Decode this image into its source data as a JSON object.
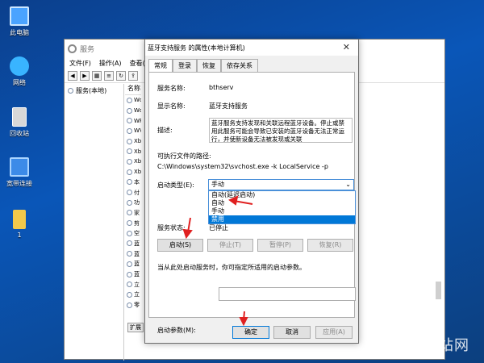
{
  "desktop": {
    "icons": [
      {
        "label": "此电脑",
        "color": "#4aa3ff"
      },
      {
        "label": "网络",
        "color": "#39b4ff"
      },
      {
        "label": "回收站",
        "color": "#d8d8d8"
      },
      {
        "label": "宽带连接",
        "color": "#3c8be8"
      },
      {
        "label": "1",
        "color": "#f1c84b"
      }
    ],
    "watermark": "贝站网"
  },
  "services_window": {
    "title": "服务",
    "menu": [
      "文件(F)",
      "操作(A)",
      "查看(V)"
    ],
    "tree_item": "服务(本地)",
    "list_header": "名称",
    "list_items": [
      "Wd",
      "Wd",
      "WP",
      "WV",
      "Xb",
      "Xb",
      "Xb",
      "Xb",
      "本",
      "付",
      "功",
      "家",
      "剪",
      "空",
      "蓝",
      "蓝",
      "蓝",
      "蓝",
      "立",
      "立",
      "零"
    ],
    "ext_tab": "扩展"
  },
  "dialog": {
    "title": "蓝牙支持服务 的属性(本地计算机)",
    "tabs": [
      "常规",
      "登录",
      "恢复",
      "依存关系"
    ],
    "service_name_label": "服务名称:",
    "service_name": "bthserv",
    "display_name_label": "显示名称:",
    "display_name": "蓝牙支持服务",
    "desc_label": "描述:",
    "desc": "蓝牙服务支持发现和关联远程蓝牙设备。停止或禁用此服务可能会导致已安装的蓝牙设备无法正常运行，并使新设备无法被发现或关联",
    "exe_label": "可执行文件的路径:",
    "exe_path": "C:\\Windows\\system32\\svchost.exe -k LocalService -p",
    "startup_label": "启动类型(E):",
    "startup_value": "手动",
    "startup_options": [
      "自动(延迟启动)",
      "自动",
      "手动",
      "禁用"
    ],
    "highlighted_option": "禁用",
    "status_label": "服务状态:",
    "status_value": "已停止",
    "btn_start": "启动(S)",
    "btn_stop": "停止(T)",
    "btn_pause": "暂停(P)",
    "btn_resume": "恢复(R)",
    "hint": "当从此处启动服务时，你可指定所适用的启动参数。",
    "param_label": "启动参数(M):",
    "btn_ok": "确定",
    "btn_cancel": "取消",
    "btn_apply": "应用(A)"
  }
}
